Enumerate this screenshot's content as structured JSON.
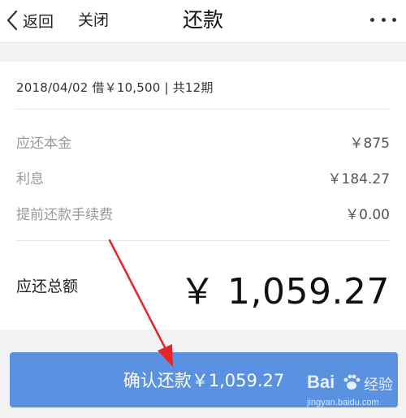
{
  "navbar": {
    "back_label": "返回",
    "close_label": "关闭",
    "title": "还款"
  },
  "loan": {
    "summary": "2018/04/02 借￥10,500 | 共12期"
  },
  "breakdown": [
    {
      "label": "应还本金",
      "value": "￥875"
    },
    {
      "label": "利息",
      "value": "￥184.27"
    },
    {
      "label": "提前还款手续费",
      "value": "￥0.00"
    }
  ],
  "total": {
    "label": "应还总额",
    "value": "￥ 1,059.27"
  },
  "confirm_button": {
    "label": "确认还款￥1,059.27"
  },
  "watermark": {
    "brand": "Bai",
    "brand_cn": "经验",
    "url": "jingyan.baidu.com"
  },
  "colors": {
    "button_bg": "#5a91e0",
    "annotation_arrow": "#e8242b",
    "page_bg": "#f2f2f2"
  }
}
